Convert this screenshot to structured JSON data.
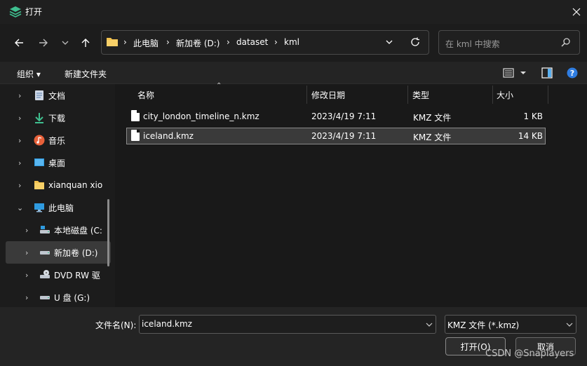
{
  "window": {
    "title": "打开"
  },
  "address": {
    "crumbs": [
      "此电脑",
      "新加卷 (D:)",
      "dataset",
      "kml"
    ]
  },
  "search": {
    "placeholder": "在 kml 中搜索"
  },
  "commandbar": {
    "organize": "组织 ▾",
    "new_folder": "新建文件夹"
  },
  "sidebar": {
    "items": [
      {
        "label": "文档",
        "icon": "document-icon"
      },
      {
        "label": "下载",
        "icon": "download-icon"
      },
      {
        "label": "音乐",
        "icon": "music-icon"
      },
      {
        "label": "桌面",
        "icon": "desktop-icon"
      },
      {
        "label": "xianquan xion",
        "icon": "folder-icon"
      },
      {
        "label": "此电脑",
        "icon": "computer-icon"
      },
      {
        "label": "本地磁盘 (C:",
        "icon": "drive-icon"
      },
      {
        "label": "新加卷 (D:)",
        "icon": "drive-icon"
      },
      {
        "label": "DVD RW 驱",
        "icon": "dvd-icon"
      },
      {
        "label": "U 盘 (G:)",
        "icon": "usb-icon"
      }
    ]
  },
  "columns": {
    "name": "名称",
    "date": "修改日期",
    "type": "类型",
    "size": "大小"
  },
  "files": [
    {
      "name": "city_london_timeline_n.kmz",
      "date": "2023/4/19 7:11",
      "type": "KMZ 文件",
      "size": "1 KB"
    },
    {
      "name": "iceland.kmz",
      "date": "2023/4/19 7:11",
      "type": "KMZ 文件",
      "size": "14 KB"
    }
  ],
  "footer": {
    "filename_label": "文件名(N):",
    "filename_value": "iceland.kmz",
    "filetype_value": "KMZ 文件 (*.kmz)",
    "open_label": "打开(O)",
    "cancel_label": "取消",
    "watermark": "CSDN @Snaplayers"
  }
}
